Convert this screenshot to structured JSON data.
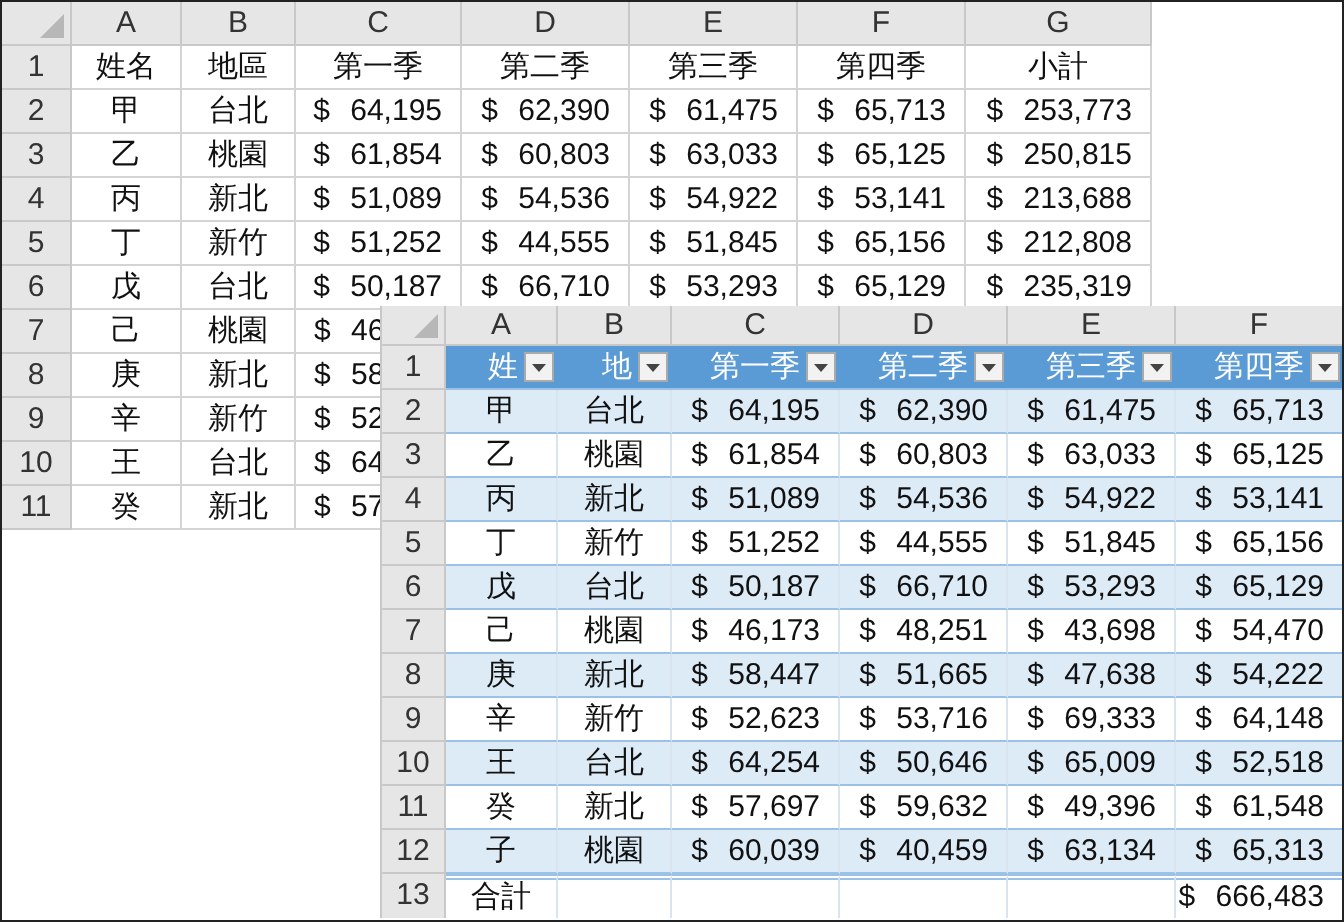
{
  "back_sheet": {
    "column_headers": [
      "A",
      "B",
      "C",
      "D",
      "E",
      "F",
      "G"
    ],
    "rows": [
      {
        "number": "1",
        "cells": [
          "姓名",
          "地區",
          "第一季",
          "第二季",
          "第三季",
          "第四季",
          "小計"
        ]
      },
      {
        "number": "2",
        "cells": [
          "甲",
          "台北",
          "$ 64,195",
          "$ 62,390",
          "$ 61,475",
          "$ 65,713",
          "$ 253,773"
        ]
      },
      {
        "number": "3",
        "cells": [
          "乙",
          "桃園",
          "$ 61,854",
          "$ 60,803",
          "$ 63,033",
          "$ 65,125",
          "$ 250,815"
        ]
      },
      {
        "number": "4",
        "cells": [
          "丙",
          "新北",
          "$ 51,089",
          "$ 54,536",
          "$ 54,922",
          "$ 53,141",
          "$ 213,688"
        ]
      },
      {
        "number": "5",
        "cells": [
          "丁",
          "新竹",
          "$ 51,252",
          "$ 44,555",
          "$ 51,845",
          "$ 65,156",
          "$ 212,808"
        ]
      },
      {
        "number": "6",
        "cells": [
          "戊",
          "台北",
          "$ 50,187",
          "$ 66,710",
          "$ 53,293",
          "$ 65,129",
          "$ 235,319"
        ]
      },
      {
        "number": "7",
        "cells": [
          "己",
          "桃園",
          "$ 46"
        ]
      },
      {
        "number": "8",
        "cells": [
          "庚",
          "新北",
          "$ 58"
        ]
      },
      {
        "number": "9",
        "cells": [
          "辛",
          "新竹",
          "$ 52"
        ]
      },
      {
        "number": "10",
        "cells": [
          "王",
          "台北",
          "$ 64"
        ]
      },
      {
        "number": "11",
        "cells": [
          "癸",
          "新北",
          "$ 57"
        ]
      }
    ]
  },
  "front_sheet": {
    "column_headers": [
      "A",
      "B",
      "C",
      "D",
      "E",
      "F"
    ],
    "header_row": {
      "number": "1",
      "cells": [
        {
          "text": "姓",
          "filter": true
        },
        {
          "text": "地",
          "filter": true
        },
        {
          "text": "第一季",
          "filter": true
        },
        {
          "text": "第二季",
          "filter": true
        },
        {
          "text": "第三季",
          "filter": true
        },
        {
          "text": "第四季",
          "filter": true
        }
      ]
    },
    "rows": [
      {
        "number": "2",
        "cells": [
          "甲",
          "台北",
          "$ 64,195",
          "$ 62,390",
          "$ 61,475",
          "$ 65,713"
        ]
      },
      {
        "number": "3",
        "cells": [
          "乙",
          "桃園",
          "$ 61,854",
          "$ 60,803",
          "$ 63,033",
          "$ 65,125"
        ]
      },
      {
        "number": "4",
        "cells": [
          "丙",
          "新北",
          "$ 51,089",
          "$ 54,536",
          "$ 54,922",
          "$ 53,141"
        ]
      },
      {
        "number": "5",
        "cells": [
          "丁",
          "新竹",
          "$ 51,252",
          "$ 44,555",
          "$ 51,845",
          "$ 65,156"
        ]
      },
      {
        "number": "6",
        "cells": [
          "戊",
          "台北",
          "$ 50,187",
          "$ 66,710",
          "$ 53,293",
          "$ 65,129"
        ]
      },
      {
        "number": "7",
        "cells": [
          "己",
          "桃園",
          "$ 46,173",
          "$ 48,251",
          "$ 43,698",
          "$ 54,470"
        ]
      },
      {
        "number": "8",
        "cells": [
          "庚",
          "新北",
          "$ 58,447",
          "$ 51,665",
          "$ 47,638",
          "$ 54,222"
        ]
      },
      {
        "number": "9",
        "cells": [
          "辛",
          "新竹",
          "$ 52,623",
          "$ 53,716",
          "$ 69,333",
          "$ 64,148"
        ]
      },
      {
        "number": "10",
        "cells": [
          "王",
          "台北",
          "$ 64,254",
          "$ 50,646",
          "$ 65,009",
          "$ 52,518"
        ]
      },
      {
        "number": "11",
        "cells": [
          "癸",
          "新北",
          "$ 57,697",
          "$ 59,632",
          "$ 49,396",
          "$ 61,548"
        ]
      },
      {
        "number": "12",
        "cells": [
          "子",
          "桃園",
          "$ 60,039",
          "$ 40,459",
          "$ 63,134",
          "$ 65,313"
        ]
      }
    ],
    "total_row": {
      "number": "13",
      "label": "合計",
      "total": "$ 666,483"
    }
  }
}
